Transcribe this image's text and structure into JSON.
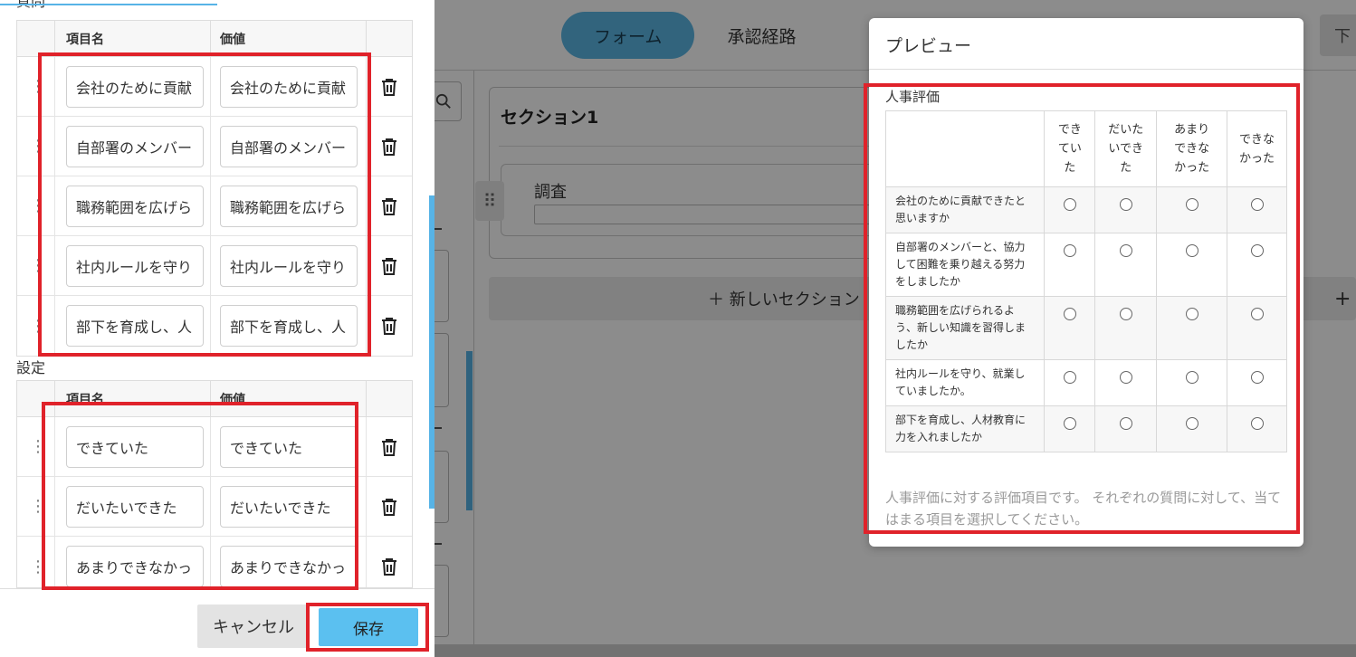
{
  "app": {
    "tabs": [
      {
        "label": "フォーム",
        "active": true
      },
      {
        "label": "承認経路",
        "active": false
      }
    ],
    "top_button_label": "下",
    "section_title": "セクション1",
    "item_label": "調査",
    "new_section_label": "＋  新しいセクション",
    "new_section_plus": "+"
  },
  "panel": {
    "top_label": "質問",
    "questions_header": {
      "name": "項目名",
      "value": "価値"
    },
    "questions": [
      {
        "name": "会社のために貢献",
        "value": "会社のために貢献"
      },
      {
        "name": "自部署のメンバー",
        "value": "自部署のメンバー"
      },
      {
        "name": "職務範囲を広げら",
        "value": "職務範囲を広げら"
      },
      {
        "name": "社内ルールを守り",
        "value": "社内ルールを守り"
      },
      {
        "name": "部下を育成し、人",
        "value": "部下を育成し、人"
      }
    ],
    "settings_label": "設定",
    "settings_header": {
      "name": "項目名",
      "value": "価値"
    },
    "settings": [
      {
        "name": "できていた",
        "value": "できていた"
      },
      {
        "name": "だいたいできた",
        "value": "だいたいできた"
      },
      {
        "name": "あまりできなかっ",
        "value": "あまりできなかっ"
      }
    ],
    "cancel_label": "キャンセル",
    "save_label": "保存"
  },
  "preview": {
    "title": "プレビュー",
    "survey_title": "人事評価",
    "columns": [
      "できていた",
      "だいたいできた",
      "あまりできなかった",
      "できなかった"
    ],
    "rows": [
      "会社のために貢献できたと思いますか",
      "自部署のメンバーと、協力して困難を乗り越える努力をしましたか",
      "職務範囲を広げられるよう、新しい知識を習得しましたか",
      "社内ルールを守り、就業していましたか。",
      "部下を育成し、人材教育に力を入れましたか"
    ],
    "description": "人事評価に対する評価項目です。 それぞれの質問に対して、当てはまる項目を選択してください。"
  },
  "colors": {
    "accent": "#5bc0f0",
    "highlight": "#e0222a"
  }
}
